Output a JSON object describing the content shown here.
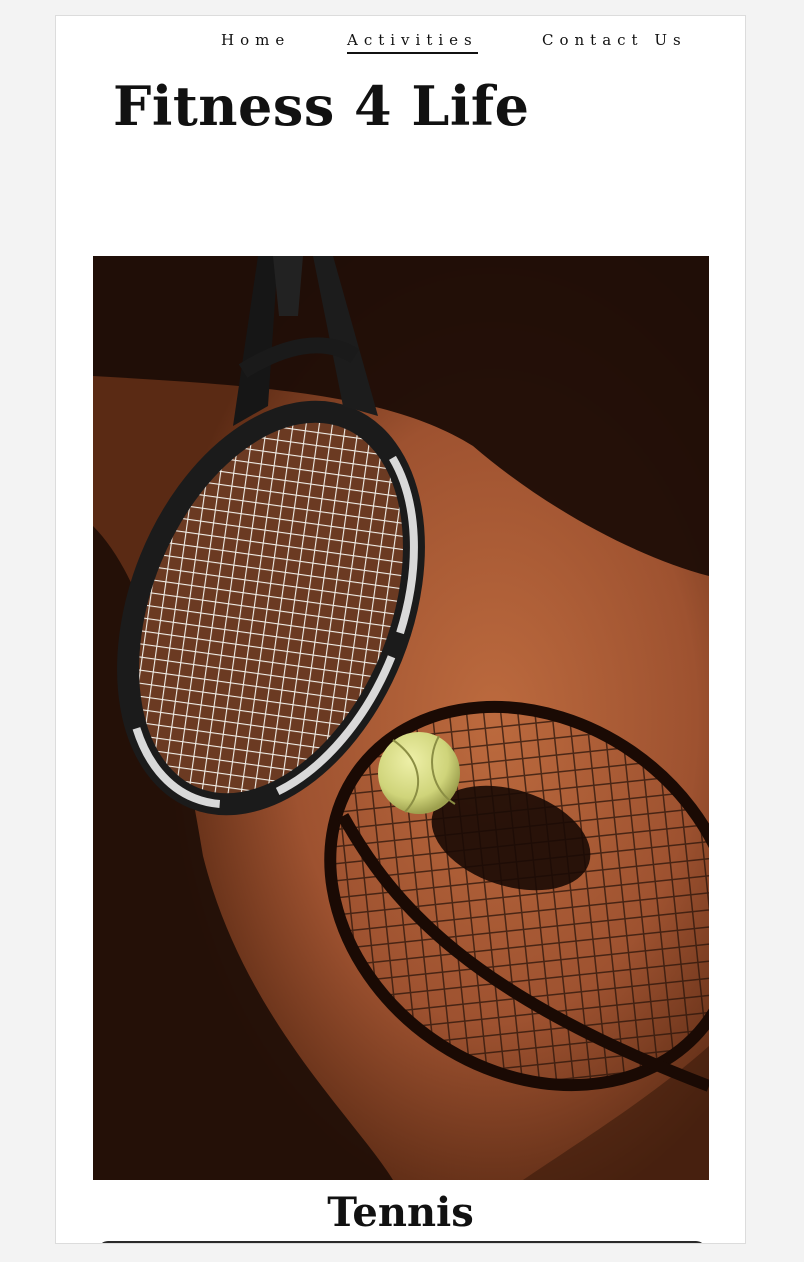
{
  "nav": {
    "items": [
      {
        "label": "Home",
        "active": false
      },
      {
        "label": "Activities",
        "active": true
      },
      {
        "label": "Contact Us",
        "active": false
      }
    ]
  },
  "site": {
    "title": "Fitness 4 Life"
  },
  "activity": {
    "name": "Tennis",
    "image_subject": "tennis racket and tennis ball on clay court"
  },
  "colors": {
    "court": "#9a4e2c",
    "court_light": "#b8673c",
    "shadow": "#1b0c05",
    "ball": "#d6dc82"
  }
}
